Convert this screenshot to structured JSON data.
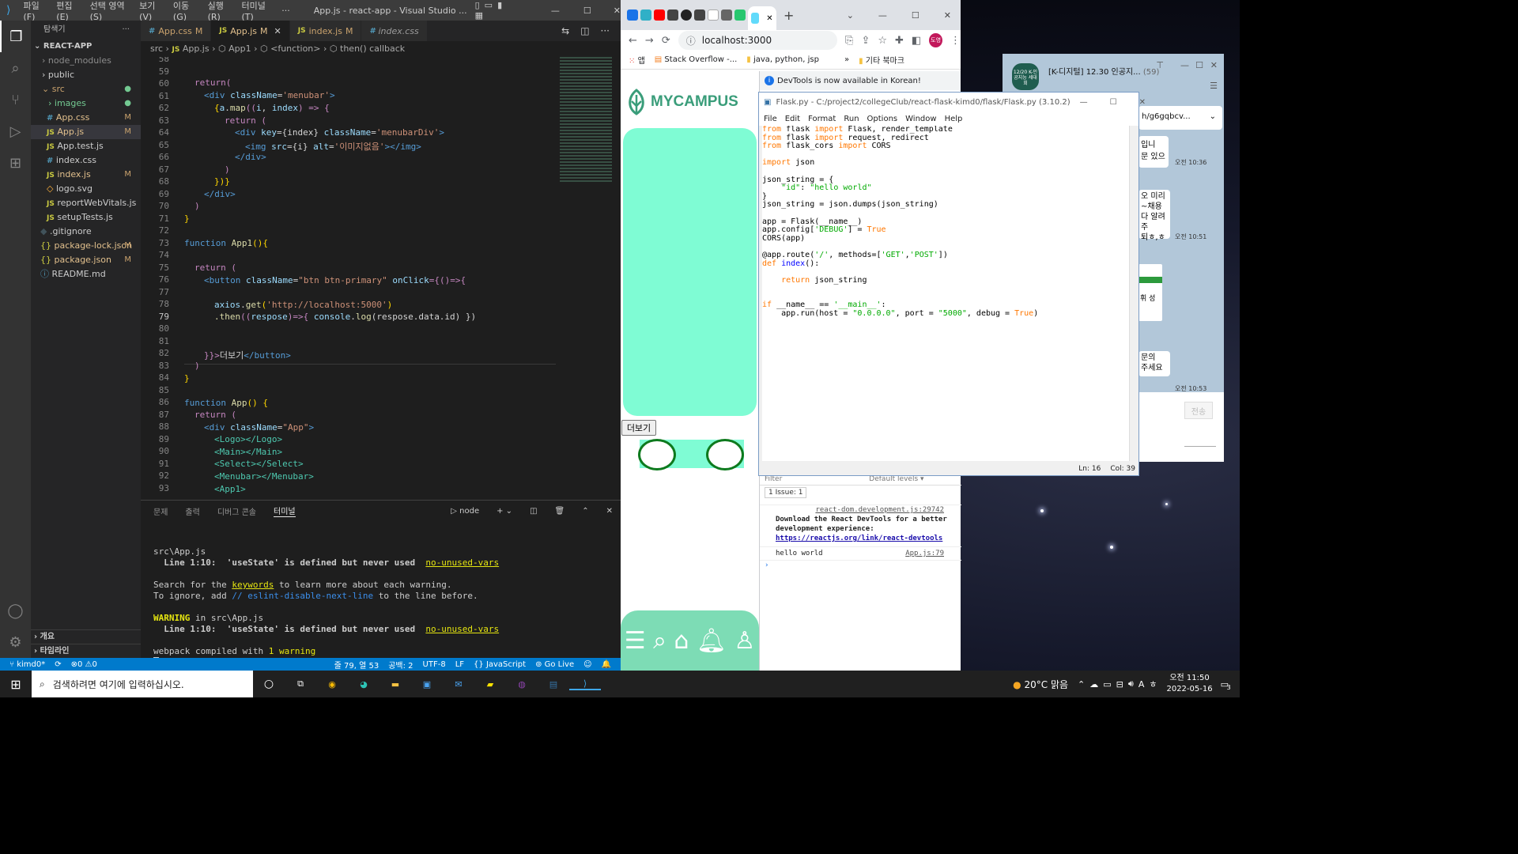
{
  "colors": {
    "vscode_bg": "#1e1e1e",
    "vscode_status": "#007acc",
    "mycampus_green": "#7ffcd4",
    "mycampus_brand": "#3a9d7a",
    "taskbar": "#202020"
  },
  "vscode": {
    "title_menus": [
      "파일(F)",
      "편집(E)",
      "선택 영역(S)",
      "보기(V)",
      "이동(G)",
      "실행(R)",
      "터미널(T)",
      "···"
    ],
    "window_title": "App.js - react-app - Visual Studio ...",
    "explorer_title": "탐색기",
    "project": "REACT-APP",
    "tree": [
      {
        "label": "node_modules",
        "kind": "folder"
      },
      {
        "label": "public",
        "kind": "folder"
      },
      {
        "label": "src",
        "kind": "folder-open"
      },
      {
        "label": "images",
        "kind": "folder"
      },
      {
        "label": "App.css",
        "kind": "file",
        "mark": "M"
      },
      {
        "label": "App.js",
        "kind": "file",
        "mark": "M"
      },
      {
        "label": "App.test.js",
        "kind": "file"
      },
      {
        "label": "index.css",
        "kind": "file"
      },
      {
        "label": "index.js",
        "kind": "file",
        "mark": "M"
      },
      {
        "label": "logo.svg",
        "kind": "file"
      },
      {
        "label": "reportWebVitals.js",
        "kind": "file"
      },
      {
        "label": "setupTests.js",
        "kind": "file"
      },
      {
        "label": ".gitignore",
        "kind": "file"
      },
      {
        "label": "package-lock.json",
        "kind": "file",
        "mark": "M"
      },
      {
        "label": "package.json",
        "kind": "file",
        "mark": "M"
      },
      {
        "label": "README.md",
        "kind": "file"
      }
    ],
    "outline": "개요",
    "timeline": "타임라인",
    "tabs": [
      {
        "label": "App.css",
        "mark": "M"
      },
      {
        "label": "App.js",
        "mark": "M"
      },
      {
        "label": "index.js",
        "mark": "M"
      },
      {
        "label": "index.css",
        "mark": ""
      }
    ],
    "breadcrumb": [
      "src",
      "App.js",
      "App1",
      "<function>",
      "then() callback"
    ],
    "line_numbers": [
      "58",
      "59",
      "60",
      "61",
      "62",
      "63",
      "64",
      "65",
      "66",
      "67",
      "68",
      "69",
      "70",
      "71",
      "72",
      "73",
      "74",
      "75",
      "76",
      "77",
      "78",
      "79",
      "80",
      "81",
      "82",
      "83",
      "84",
      "85",
      "86",
      "87",
      "88",
      "89",
      "90",
      "91",
      "92",
      "93"
    ],
    "code": {
      "l60": "return(",
      "l61a": "<div ",
      "l61b": "className",
      "l61c": "=",
      "l61d": "'menubar'",
      "l61e": ">",
      "l62a": "{",
      "l62b": "a",
      "l62c": ".",
      "l62d": "map",
      "l62e": "((",
      "l62f": "i",
      "l62g": ", ",
      "l62h": "index",
      "l62i": ") => {",
      "l63": "return (",
      "l64a": "<div ",
      "l64b": "key",
      "l64c": "={index} ",
      "l64d": "className",
      "l64e": "=",
      "l64f": "'menubarDiv'",
      "l64g": ">",
      "l65a": "<img ",
      "l65b": "src",
      "l65c": "={i} ",
      "l65d": "alt",
      "l65e": "=",
      "l65f": "'이미지없음'",
      "l65g": "></img>",
      "l66": "</div>",
      "l67": ")",
      "l68": "})}",
      "l69": "</div>",
      "l70": ")",
      "l71": "}",
      "l73a": "function ",
      "l73b": "App1",
      "l73c": "(){",
      "l75": "return (",
      "l76a": "<button ",
      "l76b": "className",
      "l76c": "=",
      "l76d": "\"btn btn-primary\"",
      "l76e": " onClick",
      "l76f": "={()=>{",
      "l78a": "axios",
      "l78b": ".",
      "l78c": "get",
      "l78d": "(",
      "l78e": "'http://localhost:5000'",
      "l78f": ")",
      "l79a": ".then",
      "l79b": "((",
      "l79c": "respose",
      "l79d": ")=>{ ",
      "l79e": "console",
      "l79f": ".",
      "l79g": "log",
      "l79h": "(respose.data.id) })",
      "l82a": "}}>",
      "l82b": "더보기",
      "l82c": "</button>",
      "l83": ")",
      "l84": "}",
      "l86a": "function ",
      "l86b": "App",
      "l86c": "() {",
      "l87": "return (",
      "l88a": "<div ",
      "l88b": "className",
      "l88c": "=",
      "l88d": "\"App\"",
      "l88e": ">",
      "l89": "<Logo></Logo>",
      "l90": "<Main></Main>",
      "l91": "<Select></Select>",
      "l92": "<Menubar></Menubar>",
      "l93": "<App1>"
    },
    "panel_tabs": [
      "문제",
      "출력",
      "디버그 콘솔",
      "터미널"
    ],
    "panel_node": "node",
    "terminal": {
      "t1": "src\\App.js",
      "t2a": "  Line 1:10:  'useState' is defined but never used  ",
      "t2b": "no-unused-vars",
      "t3a": "Search for the ",
      "t3b": "keywords",
      "t3c": " to learn more about each warning.",
      "t4a": "To ignore, add ",
      "t4b": "// eslint-disable-next-line",
      "t4c": " to the line before.",
      "t5a": "WARNING",
      "t5b": " in src\\App.js",
      "t6a": "  Line 1:10:  'useState' is defined but never used  ",
      "t6b": "no-unused-vars",
      "t7a": "webpack compiled with ",
      "t7b": "1 warning"
    },
    "status": {
      "branch": "kimd0*",
      "errors": "⊗0 ⚠0",
      "warnings": "⚠ 0",
      "position": "줄 79, 열 53",
      "spaces": "공백: 2",
      "encoding": "UTF-8",
      "eol": "LF",
      "language": "JavaScript",
      "golive": "Go Live"
    }
  },
  "chrome": {
    "url": "localhost:3000",
    "bookmarks": [
      "앱",
      "Stack Overflow -...",
      "java, python, jsp",
      "»",
      "기타 북마크"
    ],
    "profile": "도영",
    "brand": "MYCAMPUS",
    "more_button": "더보기",
    "devtools_notice": "DevTools is now available in Korean!",
    "filter_placeholder": "Filter",
    "levels": "Default levels ▾",
    "issues": "1 Issue: 1",
    "console": {
      "src1": "react-dom.development.js:29742",
      "msg1": "Download the React DevTools for a better development experience: ",
      "link1": "https://reactjs.org/link/react-devtools",
      "msg2": "hello world",
      "src2": "App.js:79"
    }
  },
  "idle": {
    "title": "Flask.py - C:/project2/collegeClub/react-flask-kimd0/flask/Flask.py (3.10.2)",
    "menus": [
      "File",
      "Edit",
      "Format",
      "Run",
      "Options",
      "Window",
      "Help"
    ],
    "status_ln": "Ln: 16",
    "status_col": "Col: 39",
    "code": {
      "c1a": "from",
      "c1b": " flask ",
      "c1c": "import",
      "c1d": " Flask, render_template",
      "c2a": "from",
      "c2b": " flask ",
      "c2c": "import",
      "c2d": " request, redirect",
      "c3a": "from",
      "c3b": " flask_cors ",
      "c3c": "import",
      "c3d": " CORS",
      "c5a": "import",
      "c5b": " json",
      "c7": "json_string = {",
      "c8a": "    ",
      "c8b": "\"id\"",
      "c8c": ": ",
      "c8d": "\"hello world\"",
      "c9": "}",
      "c10": "json_string = json.dumps(json_string)",
      "c12": "app = Flask(__name__)",
      "c13a": "app.config[",
      "c13b": "'DEBUG'",
      "c13c": "] = ",
      "c13d": "True",
      "c14": "CORS(app)",
      "c16a": "@app.route(",
      "c16b": "'/'",
      "c16c": ", methods=[",
      "c16d": "'GET'",
      "c16e": ",",
      "c16f": "'POST'",
      "c16g": "])",
      "c17a": "def ",
      "c17b": "index",
      "c17c": "():",
      "c19a": "    return",
      "c19b": " json_string",
      "c22a": "if",
      "c22b": " __name__ == ",
      "c22c": "'__main__'",
      "c22d": ":",
      "c23a": "    app.run(host = ",
      "c23b": "\"0.0.0.0\"",
      "c23c": ", port = ",
      "c23d": "\"5000\"",
      "c23e": ", debug = ",
      "c23f": "True",
      "c23g": ")"
    }
  },
  "kakao": {
    "title": "[K-디지털] 12.30 인공지...",
    "count": "(59)",
    "avatar": "12/20 K-인공지능 세대회",
    "link": "h/g6gqbcv...",
    "msgs": [
      {
        "text": "입니\n문 있으",
        "time": "오전 10:36"
      },
      {
        "text": "오 미리\n~채용\n다 알려주\n퇴ㅎ,ㅎ",
        "time": "오전 10:51"
      },
      {
        "text": "휘 성",
        "time": ""
      },
      {
        "text": "문의\n주세요",
        "time": "오전 10:53"
      }
    ],
    "send": "전송"
  },
  "taskbar": {
    "search": "검색하려면 여기에 입력하십시오.",
    "weather": "20°C 맑음",
    "ime": "A",
    "ime2": "ㅎ",
    "time": "오전 11:50",
    "date": "2022-05-16",
    "notif": "3"
  }
}
